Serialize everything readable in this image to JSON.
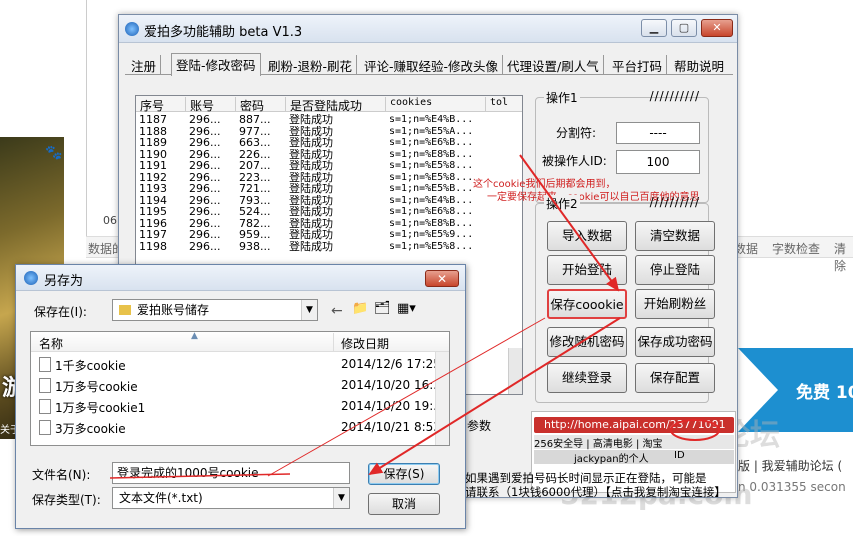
{
  "background": {
    "left_number": "06",
    "left_strip_label": "数据的",
    "strip_items": [
      "数据",
      "字数检查",
      "清除"
    ],
    "photo_label": "游",
    "photo_sub": "关于",
    "ad_text": "免费 10",
    "forum_link": "版 | 我爱辅助论坛 (",
    "timing": "n 0.031355 secon",
    "watermark1": "助论坛",
    "watermark2": "5212pa.com"
  },
  "window": {
    "title": "爱拍多功能辅助 beta V1.3",
    "tabs": [
      "注册",
      "登陆-修改密码",
      "刷粉-退粉-刷花",
      "评论-赚取经验-修改头像",
      "代理设置/刷人气",
      "平台打码",
      "帮助说明"
    ],
    "active_tab": "登陆-修改密码",
    "list": {
      "columns": [
        "序号",
        "账号",
        "密码",
        "是否登陆成功",
        "cookies",
        "tol"
      ],
      "rows": [
        [
          "1187",
          "296...",
          "887...",
          "登陆成功",
          "s=1;n=%E4%B..."
        ],
        [
          "1188",
          "296...",
          "977...",
          "登陆成功",
          "s=1;n=%E5%A..."
        ],
        [
          "1189",
          "296...",
          "663...",
          "登陆成功",
          "s=1;n=%E6%B..."
        ],
        [
          "1190",
          "296...",
          "226...",
          "登陆成功",
          "s=1;n=%E8%B..."
        ],
        [
          "1191",
          "296...",
          "207...",
          "登陆成功",
          "s=1;n=%E5%8..."
        ],
        [
          "1192",
          "296...",
          "223...",
          "登陆成功",
          "s=1;n=%E5%8..."
        ],
        [
          "1193",
          "296...",
          "721...",
          "登陆成功",
          "s=1;n=%E5%B..."
        ],
        [
          "1194",
          "296...",
          "793...",
          "登陆成功",
          "s=1;n=%E4%B..."
        ],
        [
          "1195",
          "296...",
          "524...",
          "登陆成功",
          "s=1;n=%E6%8..."
        ],
        [
          "1196",
          "296...",
          "782...",
          "登陆成功",
          "s=1;n=%E8%B..."
        ],
        [
          "1197",
          "296...",
          "959...",
          "登陆成功",
          "s=1;n=%E5%9..."
        ],
        [
          "1198",
          "296...",
          "938...",
          "登陆成功",
          "s=1;n=%E5%8..."
        ]
      ]
    },
    "group1": {
      "title": "操作1",
      "slashes": "//////////",
      "sep_label": "分割符:",
      "sep_value": "----",
      "target_label": "被操作人ID:",
      "target_value": "100"
    },
    "annotation": "这个cookie我们后期都会用到，一定要保存起来，cookie可以自己百度他的意思",
    "group2": {
      "title": "操作2",
      "slashes": "//////////",
      "buttons": [
        "导入数据",
        "清空数据",
        "开始登陆",
        "停止登陆",
        "保存coookie",
        "开始刷粉丝",
        "修改随机密码",
        "保存成功密码",
        "继续登录",
        "保存配置"
      ]
    },
    "browser": {
      "url": "http://home.aipai.com/23771091",
      "bookmarks": "256安全导 | 高清电影 | 淘宝",
      "tab_text": "jackypan的个人",
      "id_label": "ID"
    },
    "side_label": "参数",
    "description_line1": "如果遇到爱拍号码长时间显示正在登陆，可能是",
    "description_line2": "请联系（1块钱6000代理）【点击我复制淘宝连接】"
  },
  "dialog": {
    "title": "另存为",
    "save_in_label": "保存在(I):",
    "save_in_value": "爱拍账号储存",
    "columns": [
      "名称",
      "修改日期"
    ],
    "files": [
      {
        "name": "1千多cookie",
        "date": "2014/12/6 17:25"
      },
      {
        "name": "1万多号cookie",
        "date": "2014/10/20 16:..."
      },
      {
        "name": "1万多号cookie1",
        "date": "2014/10/20 19:..."
      },
      {
        "name": "3万多cookie",
        "date": "2014/10/21 8:53"
      }
    ],
    "filename_label": "文件名(N):",
    "filename_value": "登录完成的1000号cookie",
    "filetype_label": "保存类型(T):",
    "filetype_value": "文本文件(*.txt)",
    "save_button": "保存(S)",
    "cancel_button": "取消"
  }
}
